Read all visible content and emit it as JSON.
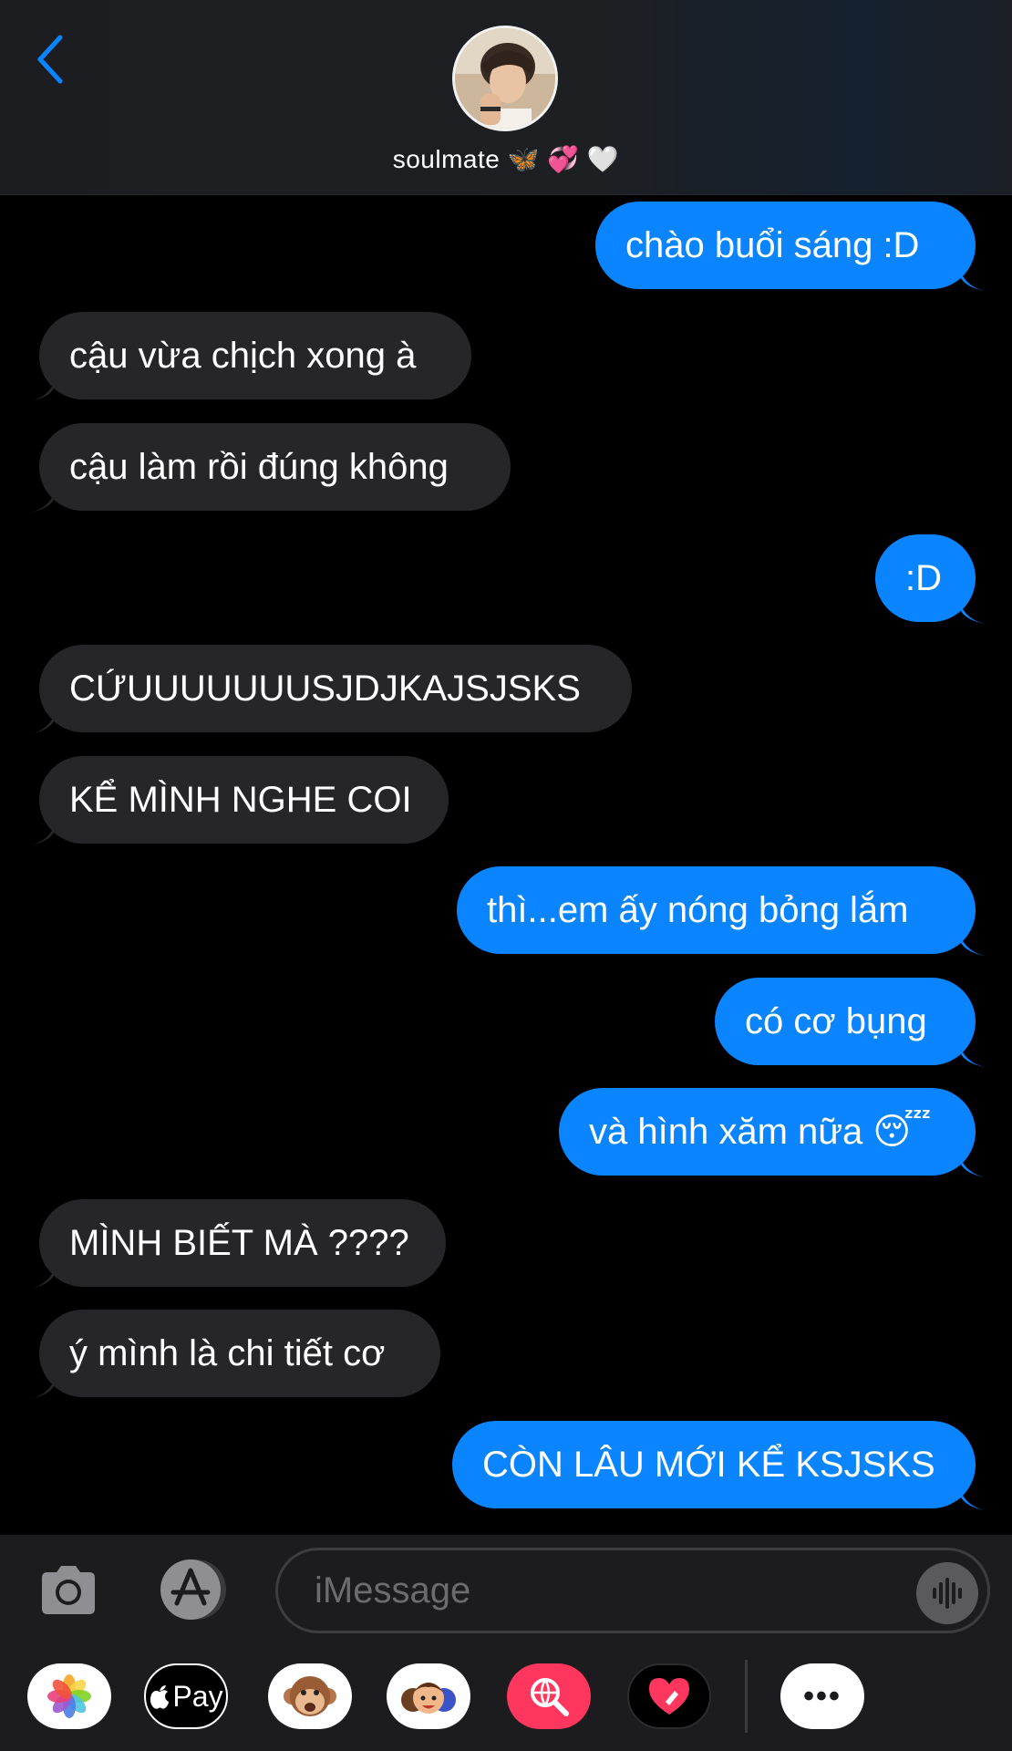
{
  "header": {
    "contact_name": "soulmate",
    "contact_emojis": "🦋 💞 🤍"
  },
  "messages": [
    {
      "dir": "out",
      "text": "chào buổi sáng :D"
    },
    {
      "dir": "in",
      "text": "cậu vừa chịch xong à"
    },
    {
      "dir": "in",
      "text": "cậu làm rồi đúng không"
    },
    {
      "dir": "out",
      "text": ":D"
    },
    {
      "dir": "in",
      "text": "CỨUUUUUUUSJDJKAJSJSKS"
    },
    {
      "dir": "in",
      "text": "KỂ MÌNH NGHE COI"
    },
    {
      "dir": "out",
      "text": "thì...em ấy nóng bỏng lắm"
    },
    {
      "dir": "out",
      "text": "có cơ bụng"
    },
    {
      "dir": "out",
      "text": "và hình xăm nữa 😴"
    },
    {
      "dir": "in",
      "text": "MÌNH BIẾT MÀ ????"
    },
    {
      "dir": "in",
      "text": "ý mình là chi tiết cơ"
    },
    {
      "dir": "out",
      "text": "CÒN LÂU MỚI KỂ KSJSKS"
    }
  ],
  "composer": {
    "placeholder": "iMessage"
  },
  "app_drawer": {
    "apple_pay_label": "Pay",
    "more_label": "•••"
  },
  "colors": {
    "outgoing_bubble": "#0a84ff",
    "incoming_bubble": "#262628",
    "accent": "#0a84ff"
  }
}
